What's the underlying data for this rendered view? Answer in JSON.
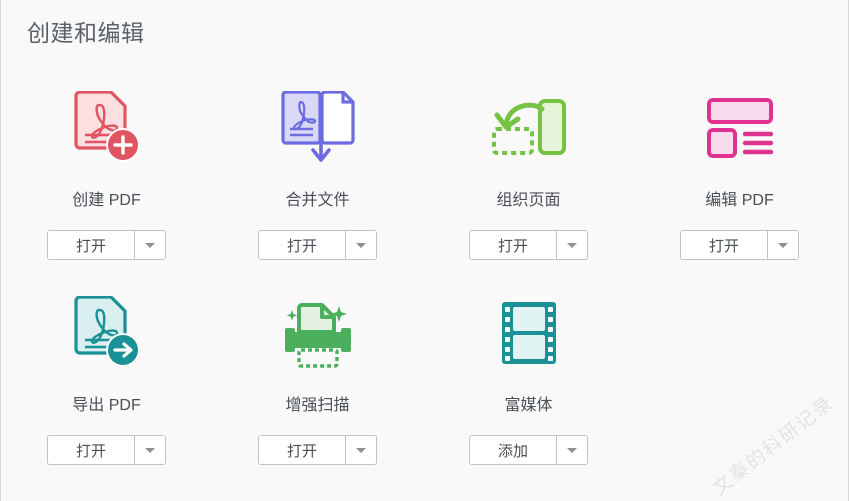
{
  "page": {
    "title": "创建和编辑",
    "background_color": "#f9f9fa",
    "title_color": "#5b6168"
  },
  "watermark": {
    "text": "文秦的科研记录",
    "color": "#e3e3e5"
  },
  "tiles": [
    {
      "id": "create-pdf",
      "label": "创建 PDF",
      "icon": "pdf-document-plus-icon",
      "color": "#e05561",
      "button": {
        "label": "打开",
        "caret": "chevron-down-icon"
      }
    },
    {
      "id": "combine-files",
      "label": "合并文件",
      "icon": "combine-documents-arrow-icon",
      "color": "#6c6ce0",
      "button": {
        "label": "打开",
        "caret": "chevron-down-icon"
      }
    },
    {
      "id": "organize-pages",
      "label": "组织页面",
      "icon": "organize-pages-rotate-icon",
      "color": "#76c344",
      "button": {
        "label": "打开",
        "caret": "chevron-down-icon"
      }
    },
    {
      "id": "edit-pdf",
      "label": "编辑 PDF",
      "icon": "edit-layout-icon",
      "color": "#e0338f",
      "button": {
        "label": "打开",
        "caret": "chevron-down-icon"
      }
    },
    {
      "id": "export-pdf",
      "label": "导出 PDF",
      "icon": "pdf-document-arrow-icon",
      "color": "#1a9197",
      "button": {
        "label": "打开",
        "caret": "chevron-down-icon"
      }
    },
    {
      "id": "enhance-scan",
      "label": "增强扫描",
      "icon": "scanner-sparkle-icon",
      "color": "#4caf5d",
      "button": {
        "label": "打开",
        "caret": "chevron-down-icon"
      }
    },
    {
      "id": "rich-media",
      "label": "富媒体",
      "icon": "film-strip-icon",
      "color": "#1a9197",
      "button": {
        "label": "添加",
        "caret": "chevron-down-icon"
      }
    }
  ]
}
